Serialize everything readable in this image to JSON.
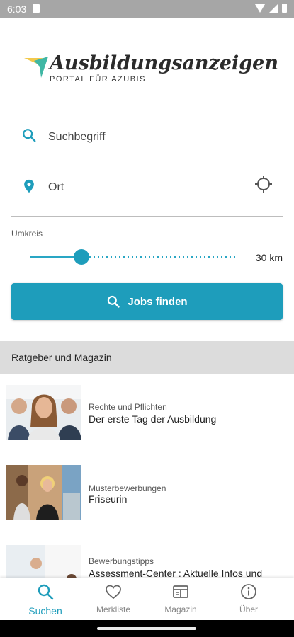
{
  "status": {
    "time": "6:03"
  },
  "logo": {
    "name": "Ausbildungsanzeigen",
    "tagline": "PORTAL FÜR AZUBIS"
  },
  "search": {
    "placeholder": "Suchbegriff",
    "value": ""
  },
  "location": {
    "placeholder": "Ort",
    "value": ""
  },
  "radius": {
    "label": "Umkreis",
    "value_text": "30 km",
    "slider_fraction": 0.25
  },
  "find_button": {
    "label": "Jobs finden"
  },
  "section": {
    "title": "Ratgeber und Magazin"
  },
  "articles": [
    {
      "category": "Rechte und Pflichten",
      "title": "Der erste Tag der Ausbildung"
    },
    {
      "category": "Musterbewerbungen",
      "title": "Friseurin"
    },
    {
      "category": "Bewerbungstipps",
      "title": "Assessment-Center : Aktuelle Infos und"
    }
  ],
  "nav": [
    {
      "label": "Suchen",
      "icon": "search-icon",
      "active": true
    },
    {
      "label": "Merkliste",
      "icon": "heart-icon",
      "active": false
    },
    {
      "label": "Magazin",
      "icon": "newspaper-icon",
      "active": false
    },
    {
      "label": "Über",
      "icon": "info-icon",
      "active": false
    }
  ],
  "colors": {
    "accent": "#1e9dbb",
    "section_bg": "#dcdcdc",
    "status_bar": "#a6a6a6",
    "logo_yellow": "#f2c94c",
    "logo_teal": "#3fb7a4"
  }
}
